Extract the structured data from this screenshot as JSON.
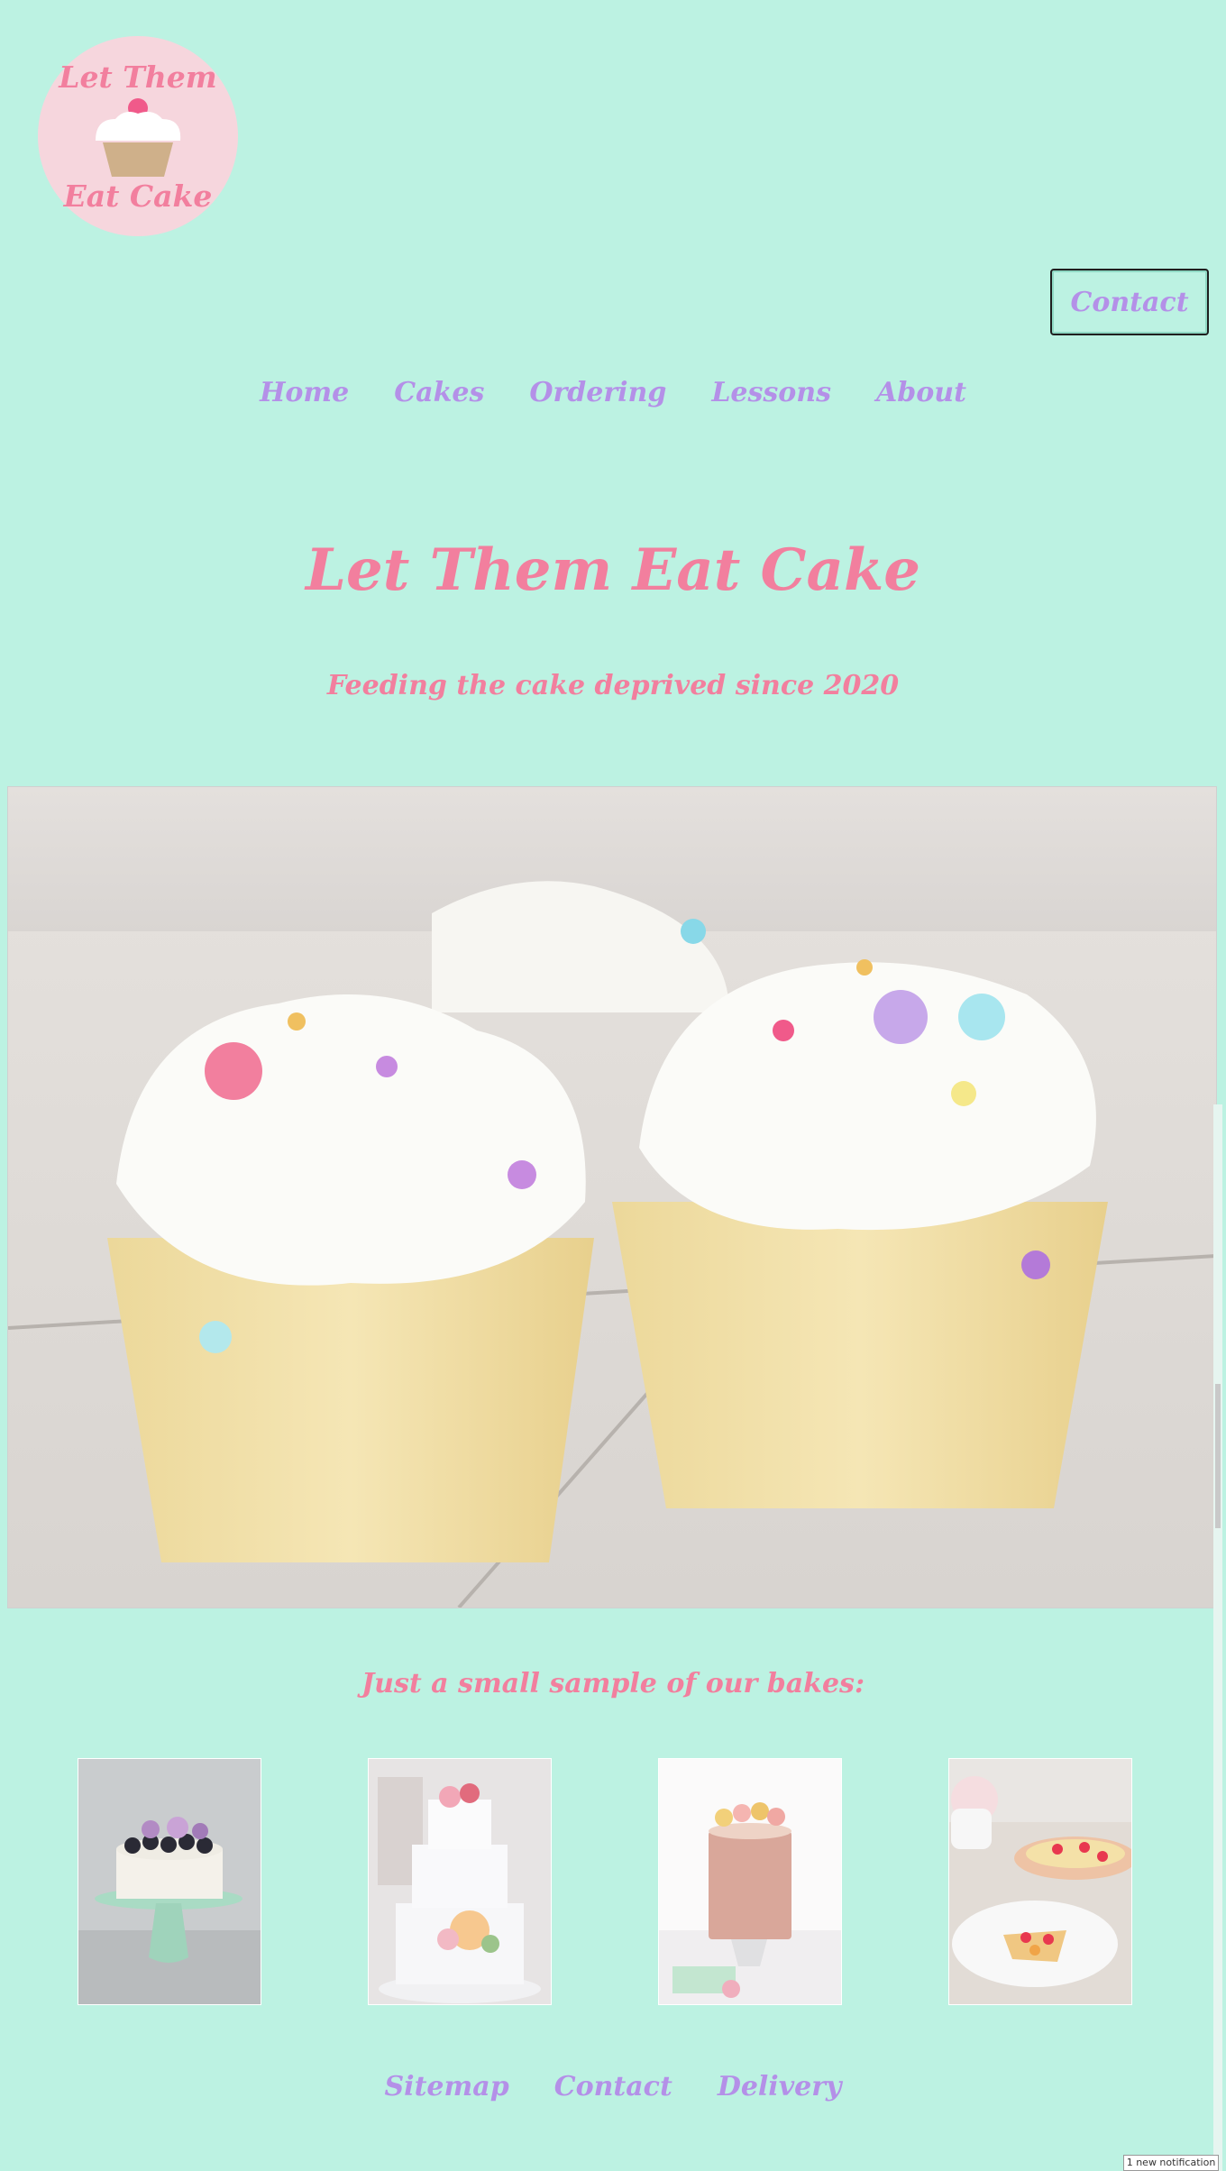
{
  "logo": {
    "top_text": "Let Them",
    "bottom_text": "Eat Cake"
  },
  "header": {
    "contact_label": "Contact"
  },
  "nav": {
    "items": [
      "Home",
      "Cakes",
      "Ordering",
      "Lessons",
      "About"
    ]
  },
  "hero": {
    "title": "Let Them Eat Cake",
    "subtitle": "Feeding the cake deprived since 2020"
  },
  "gallery": {
    "heading": "Just a small sample of our bakes:"
  },
  "footer": {
    "items": [
      "Sitemap",
      "Contact",
      "Delivery"
    ]
  },
  "notification": {
    "text": "1 new notification"
  },
  "colors": {
    "background": "#bcf2e2",
    "pink": "#f27f9e",
    "purple": "#b490e8",
    "logo_bg": "#f6d6dd"
  }
}
